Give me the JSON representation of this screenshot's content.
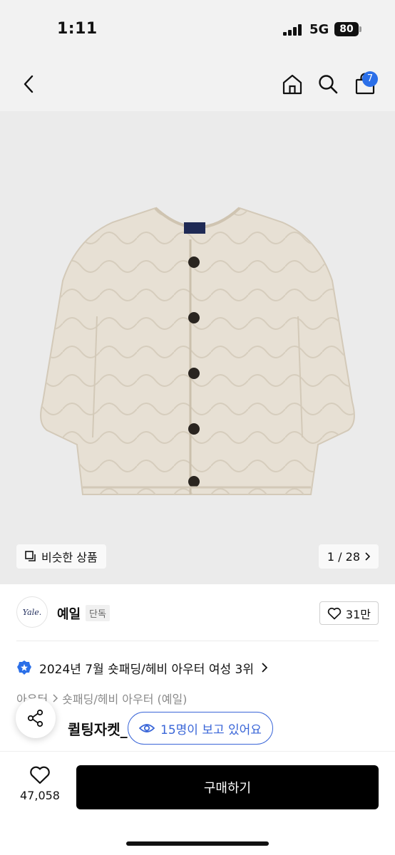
{
  "status_bar": {
    "time": "1:11",
    "network": "5G",
    "battery": "80"
  },
  "nav": {
    "cart_count": "7"
  },
  "gallery": {
    "similar_label": "비슷한 상품",
    "counter": "1 / 28"
  },
  "brand": {
    "logo_text": "Yale.",
    "name": "예일",
    "exclusive_badge": "단독",
    "likes": "31만"
  },
  "ranking": {
    "text": "2024년 7월 숏패딩/헤비 아우터 여성 3위"
  },
  "breadcrumb": {
    "category": "아우터",
    "subcategory": "숏패딩/헤비 아우터 (예일)"
  },
  "product": {
    "title_partial": "퀼팅자켓_C"
  },
  "viewers": {
    "text": "15명이 보고 있어요"
  },
  "bottom_bar": {
    "wish_count": "47,058",
    "buy_label": "구매하기"
  },
  "colors": {
    "accent_blue": "#3a66d8",
    "badge_blue": "#2b6fe8",
    "buy_button": "#000000",
    "jacket": "#e7e0d4"
  }
}
